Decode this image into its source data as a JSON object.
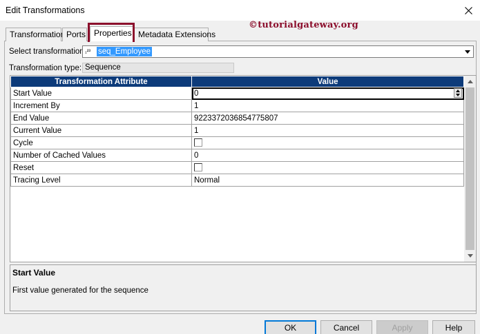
{
  "window": {
    "title": "Edit Transformations"
  },
  "watermark": "©tutorialgateway.org",
  "tabs": [
    {
      "label": "Transformation"
    },
    {
      "label": "Ports"
    },
    {
      "label": "Properties"
    },
    {
      "label": "Metadata Extensions"
    }
  ],
  "select_transformation": {
    "label": "Select transformation:",
    "icon_text": "₁²³",
    "value": "seq_Employee"
  },
  "transformation_type": {
    "label": "Transformation type:",
    "value": "Sequence"
  },
  "grid": {
    "headers": [
      "Transformation Attribute",
      "Value"
    ],
    "rows": [
      {
        "attribute": "Start Value",
        "value": "0"
      },
      {
        "attribute": "Increment By",
        "value": "1"
      },
      {
        "attribute": "End Value",
        "value": "9223372036854775807"
      },
      {
        "attribute": "Current Value",
        "value": "1"
      },
      {
        "attribute": "Cycle",
        "value": ""
      },
      {
        "attribute": "Number of Cached Values",
        "value": "0"
      },
      {
        "attribute": "Reset",
        "value": ""
      },
      {
        "attribute": "Tracing Level",
        "value": "Normal"
      }
    ]
  },
  "description": {
    "title": "Start Value",
    "text": "First value generated for the sequence"
  },
  "buttons": {
    "ok": "OK",
    "cancel": "Cancel",
    "apply": "Apply",
    "help": "Help"
  },
  "colors": {
    "header_bg": "#0d3b7a",
    "selection": "#3399ff",
    "highlight_border": "#8b0d2b"
  }
}
